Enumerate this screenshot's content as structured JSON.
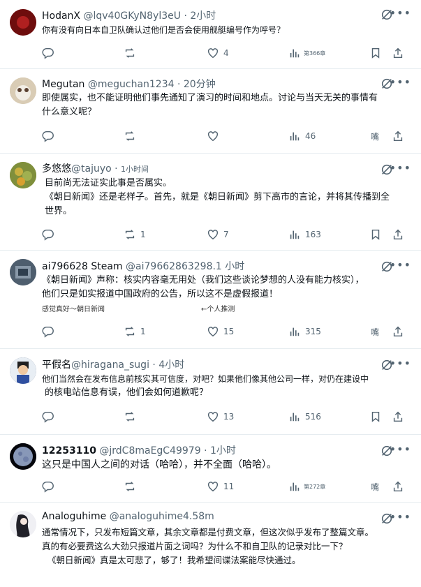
{
  "tweets": [
    {
      "name": "HodanX",
      "handle": "@lqv40GKyN8yl3eU",
      "dot": "·",
      "time": "2小时",
      "lines": [
        "你有没有向日本自卫队确认过他们是否会使用舰艇编号作为呼号？"
      ],
      "replies": "",
      "retweets": "",
      "likes": "4",
      "views": "第366章",
      "avatar_color": "#7a1010"
    },
    {
      "name": "Megutan",
      "handle": "@meguchan1234",
      "dot": "·",
      "time": "20分钟",
      "lines": [
        "即使属实，也不能证明他们事先通知了演习的时间和地点。讨论与当天无关的事情有",
        "什么意义呢？"
      ],
      "replies": "",
      "retweets": "",
      "likes": "",
      "views": "46",
      "bookmark_text": "嘴",
      "avatar_color": "#c9b79c"
    },
    {
      "name": "多悠悠",
      "handle": "@tajuyo",
      "dot": "·",
      "time": "1小时间",
      "lines": [
        "目前尚无法证实此事是否属实。",
        "《朝日新闻》还是老样子。首先，就是《朝日新闻》剪下高市的言论，并将其传播到全",
        "世界。"
      ],
      "replies": "",
      "retweets": "1",
      "likes": "7",
      "views": "163",
      "avatar_color": "#8a9a3a"
    },
    {
      "name": "ai796628 Steam",
      "handle": "@ai79662863298.1",
      "dot": "",
      "time": "小时",
      "lines": [
        "《朝日新闻》声称：核实内容毫无用处（我们这些谈论梦想的人没有能力核实），",
        "他们只是如实报道中国政府的公告，所以这不是虚假报道！"
      ],
      "note_left": "感觉真好～朝日新闻",
      "note_right": "←个人推测",
      "replies": "",
      "retweets": "1",
      "likes": "15",
      "views": "315",
      "bookmark_text": "嘴",
      "avatar_color": "#5a6a7a"
    },
    {
      "name": "平假名",
      "handle": "@hiragana_sugi",
      "dot": "·",
      "time": "4小时",
      "lines": [
        "他们当然会在发布信息前核实其可信度，对吧？如果他们像其他公司一样，对仍在建设中",
        "的核电站信息有误，他们会如何道歉呢？"
      ],
      "replies": "",
      "retweets": "",
      "likes": "13",
      "views": "516",
      "avatar_color": "#3a4a6a"
    },
    {
      "name": "12253110",
      "handle": "@jrdC8maEgC49979",
      "dot": "·",
      "time": "1小时",
      "lines": [
        "这只是中国人之间的对话（哈哈），并不全面（哈哈）。"
      ],
      "replies": "",
      "retweets": "",
      "likes": "11",
      "views": "第272章",
      "bookmark_text": "嘴",
      "avatar_color": "#0a0a12"
    },
    {
      "name": "Analoguhime",
      "handle": "@analoguhime4.58m",
      "dot": "",
      "time": "",
      "lines": [
        "通常情况下，只发布短篇文章，其余文章都是付费文章，但这次似乎发布了整篇文章。",
        "真的有必要费这么大劲只报道片面之词吗？为什么不和自卫队的记录对比一下？",
        "《朝日新闻》真是太可悲了，够了！我希望间谍法案能尽快通过。"
      ],
      "avatar_color": "#e8e8ec"
    }
  ]
}
